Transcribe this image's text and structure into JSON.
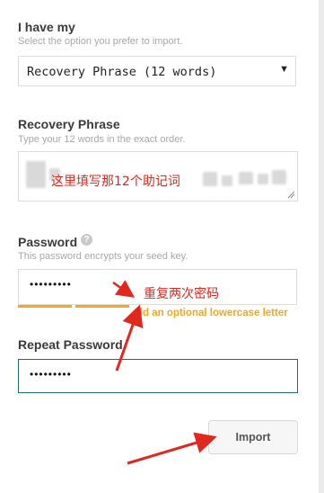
{
  "form": {
    "i_have_my": {
      "label": "I have my",
      "hint": "Select the option you prefer to import.",
      "selected": "Recovery Phrase (12 words)",
      "arrow_glyph": "▼"
    },
    "recovery_phrase": {
      "label": "Recovery Phrase",
      "hint": "Type your 12 words in the exact order.",
      "overlay_annotation": "这里填写那12个助记词"
    },
    "password": {
      "label": "Password",
      "help_glyph": "?",
      "hint": "This password encrypts your seed key.",
      "masked_value": "•••••••••",
      "strength_hint": "dd an optional lowercase letter",
      "strength_level": 0.4,
      "overlay_annotation": "重复两次密码"
    },
    "repeat_password": {
      "label": "Repeat Password",
      "masked_value": "•••••••••"
    },
    "import_button": {
      "label": "Import"
    }
  },
  "colors": {
    "annotation_red": "#e0281f",
    "strength_orange": "#f4a81c",
    "focus_border": "#1f6d73"
  },
  "icons": [
    "help-icon",
    "dropdown-arrow-icon",
    "resize-handle-icon",
    "annotation-arrow-icon"
  ]
}
